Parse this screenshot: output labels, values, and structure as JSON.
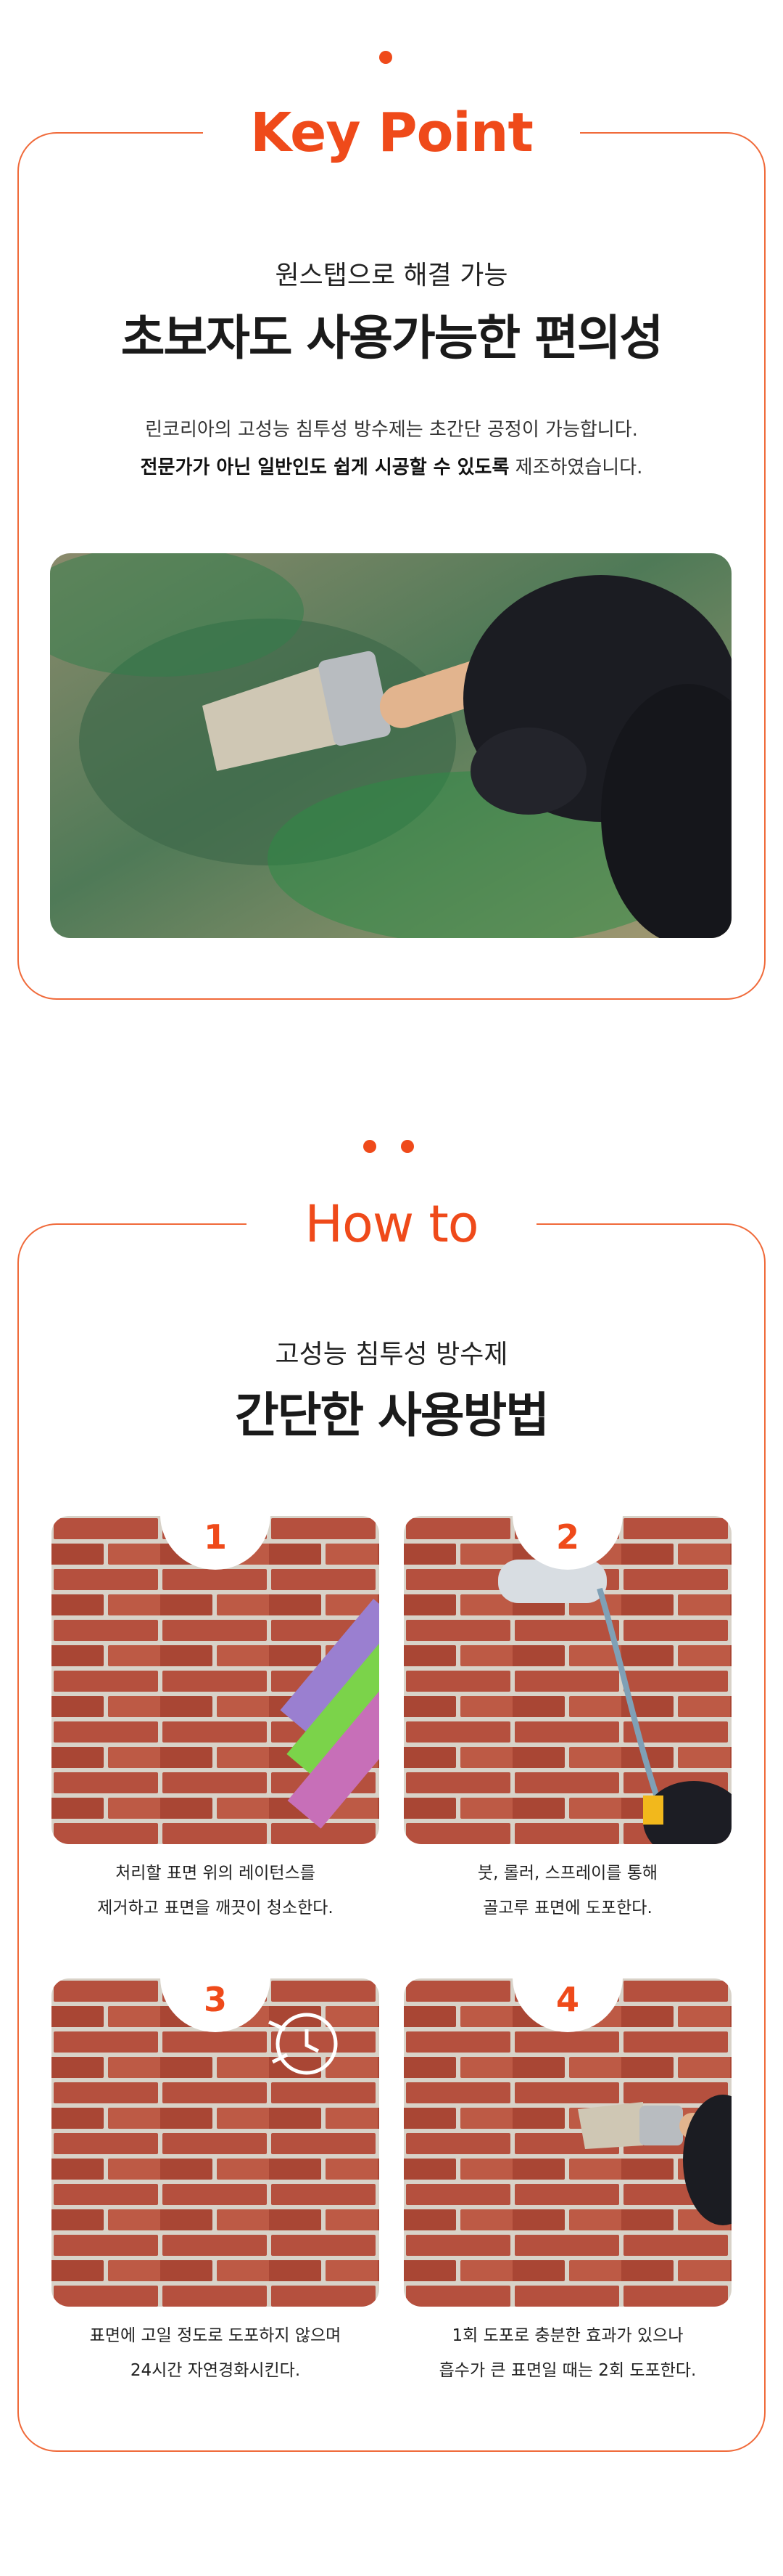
{
  "key_point": {
    "title": "Key Point",
    "subtitle": "원스탭으로 해결 가능",
    "headline": "초보자도 사용가능한 편의성",
    "desc_line1": "린코리아의 고성능 침투성 방수제는 초간단 공정이 가능합니다.",
    "desc_line2_bold": "전문가가 아닌 일반인도 쉽게 시공할 수 있도록",
    "desc_line2_rest": " 제조하였습니다."
  },
  "how_to": {
    "title": "How to",
    "subtitle": "고성능 침투성 방수제",
    "headline": "간단한 사용방법",
    "steps": [
      {
        "num": "1",
        "line1": "처리할 표면 위의 레이턴스를",
        "line2": "제거하고 표면을 깨끗이 청소한다."
      },
      {
        "num": "2",
        "line1": "붓, 롤러, 스프레이를 통해",
        "line2": "골고루 표면에 도포한다."
      },
      {
        "num": "3",
        "line1": "표면에 고일 정도로 도포하지 않으며",
        "line2": "24시간 자연경화시킨다."
      },
      {
        "num": "4",
        "line1": "1회 도포로 충분한 효과가 있으나",
        "line2": "흡수가 큰 표면일 때는 2회 도포한다."
      }
    ]
  },
  "colors": {
    "accent": "#ef4a1a",
    "frame": "#f06a3a"
  }
}
